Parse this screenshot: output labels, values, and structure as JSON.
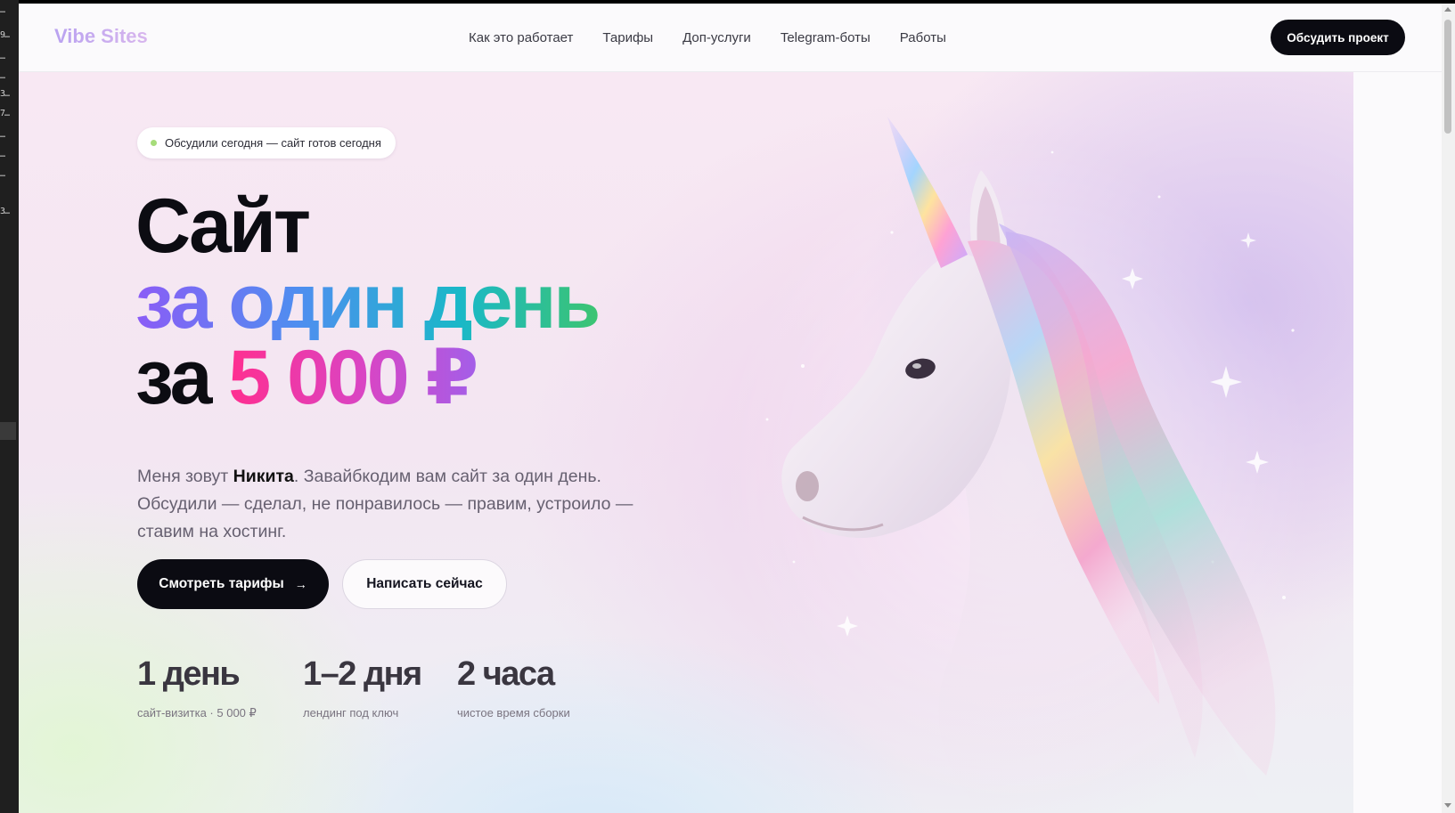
{
  "header": {
    "logo": "Vibe Sites",
    "nav": [
      "Как это работает",
      "Тарифы",
      "Доп-услуги",
      "Telegram-боты",
      "Работы"
    ],
    "cta": "Обсудить проект"
  },
  "hero": {
    "badge": "Обсудили сегодня — сайт готов сегодня",
    "title": {
      "line1": "Сайт",
      "line2": "за один день",
      "line3_prefix": "за",
      "line3_price": "5 000 ₽"
    },
    "lead": {
      "part1": "Меня зовут ",
      "name": "Никита",
      "part2": ". Завайбкодим вам сайт за один день. Обсудили — сделал, не понравилось — правим, устроило — ставим на хостинг."
    },
    "buttons": {
      "primary": "Смотреть тарифы",
      "primary_arrow": "→",
      "secondary": "Написать сейчас"
    },
    "stats": [
      {
        "value": "1 день",
        "label": "сайт-визитка · 5 000 ₽"
      },
      {
        "value": "1–2 дня",
        "label": "лендинг под ключ"
      },
      {
        "value": "2 часа",
        "label": "чистое время сборки"
      }
    ]
  },
  "icons": {
    "badge_dot": "status-dot",
    "hero_image": "unicorn-illustration"
  },
  "colors": {
    "accent_dark": "#0b0b12",
    "badge_dot": "#a6dc7a",
    "gradient_title": [
      "#8b5cf6",
      "#4f8ef0",
      "#1ab8c8",
      "#3cc472"
    ],
    "gradient_price": [
      "#ff2e8f",
      "#d945c4",
      "#a45ee8"
    ]
  }
}
